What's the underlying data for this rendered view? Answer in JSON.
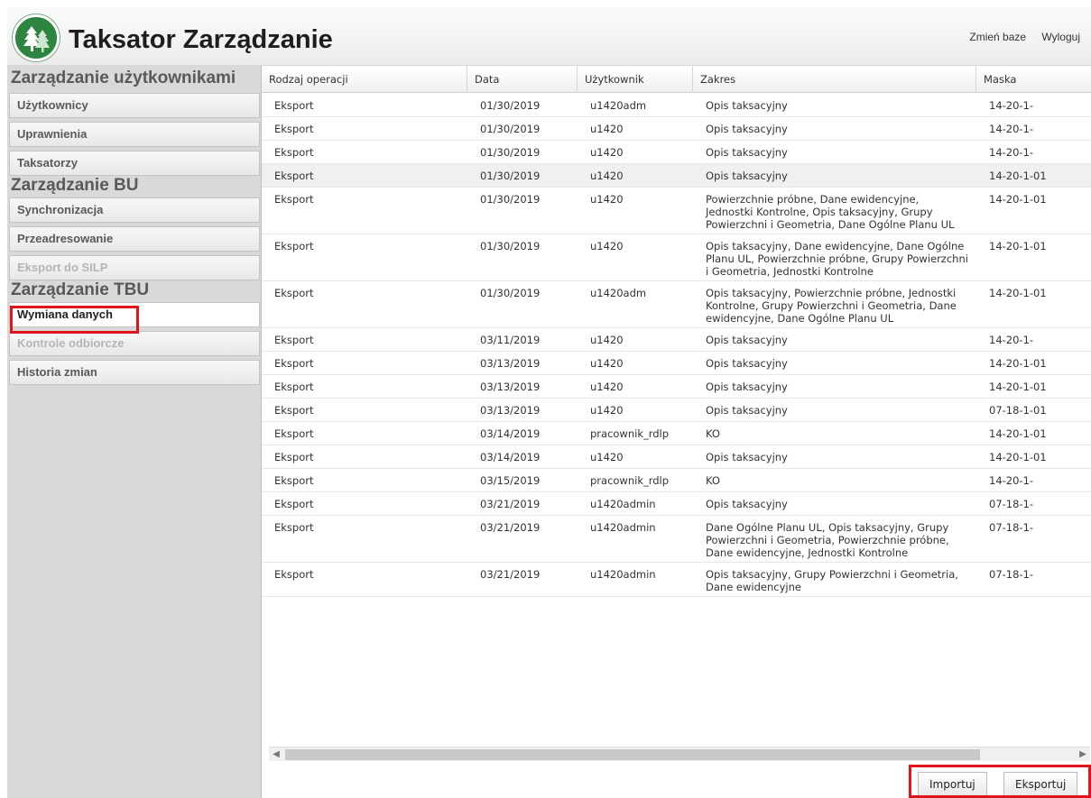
{
  "app": {
    "title": "Taksator Zarządzanie",
    "logo_icon": "tree-logo-icon"
  },
  "top_links": {
    "change_db": "Zmień baze",
    "logout": "Wyloguj"
  },
  "sidebar": {
    "sections": [
      {
        "title": "Zarządzanie użytkownikami",
        "items": [
          {
            "label": "Użytkownicy"
          },
          {
            "label": "Uprawnienia"
          },
          {
            "label": "Taksatorzy"
          }
        ]
      },
      {
        "title": "Zarządzanie BU",
        "items": [
          {
            "label": "Synchronizacja"
          },
          {
            "label": "Przeadresowanie"
          },
          {
            "label": "Eksport do SILP"
          }
        ]
      },
      {
        "title": "Zarządzanie TBU",
        "items": [
          {
            "label": "Wymiana danych"
          },
          {
            "label": "Kontrole odbiorcze"
          },
          {
            "label": "Historia zmian"
          }
        ]
      }
    ]
  },
  "table": {
    "columns": [
      "Rodzaj operacji",
      "Data",
      "Użytkownik",
      "Zakres",
      "Maska"
    ],
    "rows": [
      [
        "Eksport",
        "01/30/2019",
        "u1420adm",
        "Opis taksacyjny",
        "14-20-1-"
      ],
      [
        "Eksport",
        "01/30/2019",
        "u1420",
        "Opis taksacyjny",
        "14-20-1-"
      ],
      [
        "Eksport",
        "01/30/2019",
        "u1420",
        "Opis taksacyjny",
        "14-20-1-"
      ],
      [
        "Eksport",
        "01/30/2019",
        "u1420",
        "Opis taksacyjny",
        "14-20-1-01"
      ],
      [
        "Eksport",
        "01/30/2019",
        "u1420",
        "Powierzchnie próbne, Dane ewidencyjne, Jednostki Kontrolne, Opis taksacyjny, Grupy Powierzchni i Geometria, Dane Ogólne Planu UL",
        "14-20-1-01"
      ],
      [
        "Eksport",
        "01/30/2019",
        "u1420",
        "Opis taksacyjny, Dane ewidencyjne, Dane Ogólne Planu UL, Powierzchnie próbne, Grupy Powierzchni i Geometria, Jednostki Kontrolne",
        "14-20-1-01"
      ],
      [
        "Eksport",
        "01/30/2019",
        "u1420adm",
        "Opis taksacyjny, Powierzchnie próbne, Jednostki Kontrolne, Grupy Powierzchni i Geometria, Dane ewidencyjne, Dane Ogólne Planu UL",
        "14-20-1-01"
      ],
      [
        "Eksport",
        "03/11/2019",
        "u1420",
        "Opis taksacyjny",
        "14-20-1-"
      ],
      [
        "Eksport",
        "03/13/2019",
        "u1420",
        "Opis taksacyjny",
        "14-20-1-01"
      ],
      [
        "Eksport",
        "03/13/2019",
        "u1420",
        "Opis taksacyjny",
        "14-20-1-01"
      ],
      [
        "Eksport",
        "03/13/2019",
        "u1420",
        "Opis taksacyjny",
        "07-18-1-01"
      ],
      [
        "Eksport",
        "03/14/2019",
        "pracownik_rdlp",
        "KO",
        "14-20-1-01"
      ],
      [
        "Eksport",
        "03/14/2019",
        "u1420",
        "Opis taksacyjny",
        "14-20-1-01"
      ],
      [
        "Eksport",
        "03/15/2019",
        "pracownik_rdlp",
        "KO",
        "14-20-1-"
      ],
      [
        "Eksport",
        "03/21/2019",
        "u1420admin",
        "Opis taksacyjny",
        "07-18-1-"
      ],
      [
        "Eksport",
        "03/21/2019",
        "u1420admin",
        "Dane Ogólne Planu UL, Opis taksacyjny, Grupy Powierzchni i Geometria, Powierzchnie próbne, Dane ewidencyjne, Jednostki Kontrolne",
        "07-18-1-"
      ],
      [
        "Eksport",
        "03/21/2019",
        "u1420admin",
        "Opis taksacyjny, Grupy Powierzchni i Geometria, Dane ewidencyjne",
        "07-18-1-"
      ]
    ]
  },
  "buttons": {
    "import": "Importuj",
    "export": "Eksportuj"
  },
  "colors": {
    "highlight": "#e0141c",
    "logo_green": "#2e8540"
  }
}
